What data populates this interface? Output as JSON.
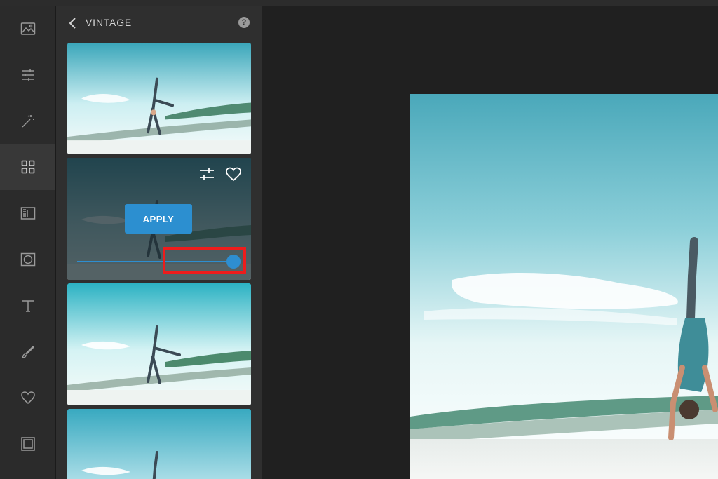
{
  "panel": {
    "title": "VINTAGE",
    "help_label": "?"
  },
  "rail": {
    "items": [
      {
        "icon": "image-icon"
      },
      {
        "icon": "sliders-icon"
      },
      {
        "icon": "magic-wand-icon"
      },
      {
        "icon": "grid-icon",
        "active": true
      },
      {
        "icon": "texture-icon"
      },
      {
        "icon": "vignette-icon"
      },
      {
        "icon": "text-icon"
      },
      {
        "icon": "brush-icon"
      },
      {
        "icon": "heart-icon"
      },
      {
        "icon": "frame-icon"
      }
    ]
  },
  "filter": {
    "apply_label": "APPLY",
    "intensity": 1.0
  },
  "colors": {
    "accent": "#2c8fd0",
    "highlight": "#ee1c1c",
    "rail_bg": "#2b2b2b",
    "panel_bg": "#2f2f2f",
    "canvas_bg": "#202020"
  }
}
